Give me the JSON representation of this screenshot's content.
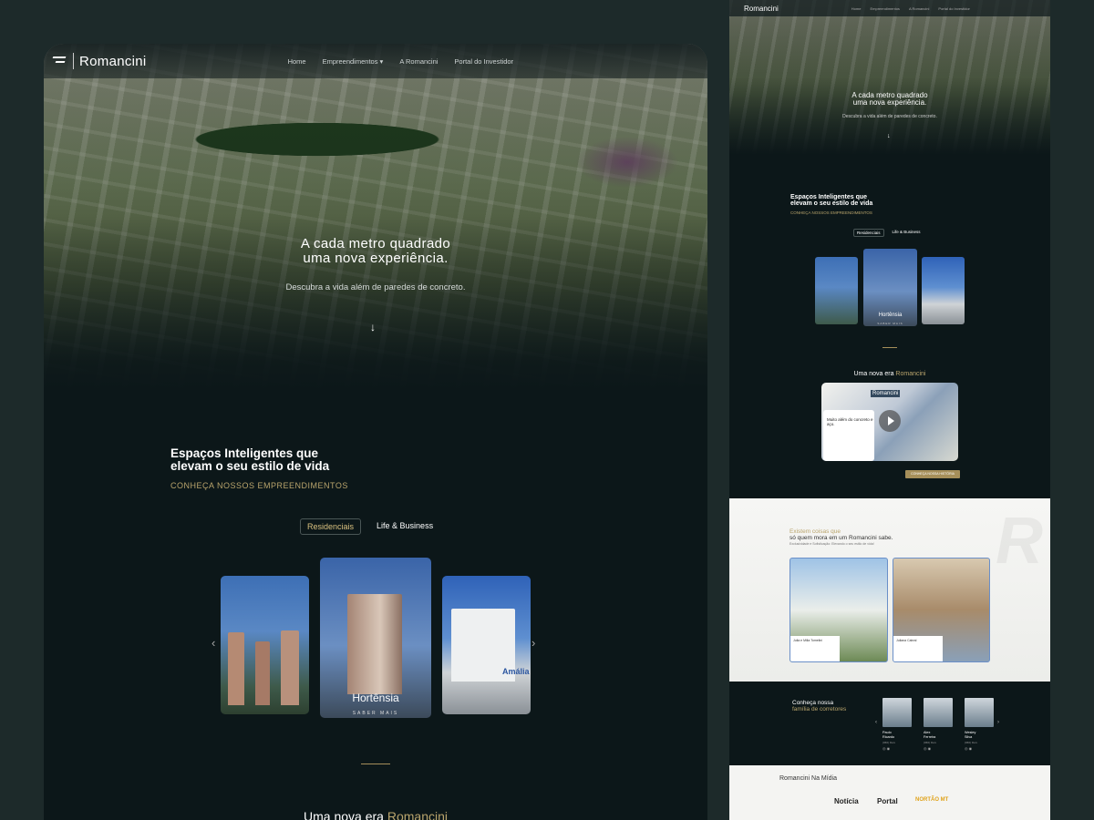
{
  "desktop": {
    "brand": "Romancini",
    "nav": [
      "Home",
      "Empreendimentos",
      "A Romancini",
      "Portal do Investidor"
    ],
    "hero_title_1": "A cada metro quadrado",
    "hero_title_2": "uma nova experiência.",
    "hero_sub": "Descubra a vida além de paredes de concreto.",
    "section_title_1": "Espaços Inteligentes que",
    "section_title_2": "elevam o seu estilo de vida",
    "section_sub": "CONHEÇA NOSSOS EMPREENDIMENTOS",
    "tabs": [
      "Residenciais",
      "Life & Business"
    ],
    "featured_name": "Hortênsia",
    "featured_more": "SABER MAIS",
    "third_card_brand": "Amália",
    "era_prefix": "Uma nova era",
    "era_brand": "Romancini"
  },
  "mobile": {
    "brand": "Romancini",
    "nav": [
      "Home",
      "Empreendimentos",
      "A Romancini",
      "Portal do Investidor"
    ],
    "hero_title_1": "A cada metro quadrado",
    "hero_title_2": "uma nova experiência.",
    "hero_sub": "Descubra a vida além de paredes de concreto.",
    "section_title_1": "Espaços Inteligentes que",
    "section_title_2": "elevam o seu estilo de vida",
    "section_sub": "CONHEÇA NOSSOS EMPREENDIMENTOS",
    "tabs": [
      "Residenciais",
      "Life & Business"
    ],
    "featured_name": "Hortênsia",
    "featured_more": "SABER MAIS",
    "era_prefix": "Uma nova era",
    "era_brand": "Romancini",
    "video_card_title": "Muito além do concreto e aço.",
    "video_brand": "Romancini",
    "cta": "CONHEÇA NOSSA HISTÓRIA",
    "white_title_1": "Existem coisas que",
    "white_title_2": "só quem mora em um Romancini sabe.",
    "white_sub": "Exclusividade e Sofisticação: Elevando o seu estilo de vida!",
    "testimonial_1": "Julia e Milla Tomelini",
    "testimonial_2": "Juliana Cabral",
    "family_1": "Conheça nossa",
    "family_2": "família de corretores",
    "agents": [
      {
        "name_1": "Paulo",
        "name_2": "Ricardo",
        "phone": "(066) 9xxx"
      },
      {
        "name_1": "Alex",
        "name_2": "Ferreira",
        "phone": "(066) 9xxx"
      },
      {
        "name_1": "Wesley",
        "name_2": "Silva",
        "phone": "(066) 9xxx"
      }
    ],
    "media_title": "Romancini Na Mídia",
    "media_logos": [
      "Notícia",
      "Portal",
      "NORTÃO MT"
    ]
  },
  "colors": {
    "background": "#1d2a2a",
    "page_dark": "#0c1719",
    "accent_gold": "#b9a46c"
  }
}
